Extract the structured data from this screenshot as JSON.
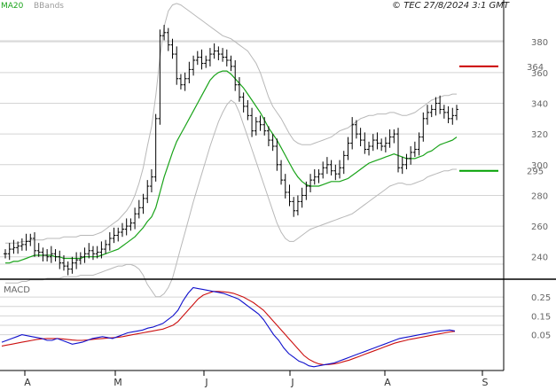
{
  "legend": {
    "ma": "MA20",
    "bb": "BBands"
  },
  "copyright": "© TEC 27/8/2024 3:1 GMT",
  "macd_label": "MACD",
  "colors": {
    "price": "#000000",
    "ma": "#19a319",
    "bands": "#b8b8b8",
    "resistance": "#cc0000",
    "support": "#00a000",
    "macd": "#1010cc",
    "signal": "#cc1010",
    "grid": "#d4d4d4"
  },
  "chart_data": {
    "type": "bar",
    "x_categories": [
      "A",
      "M",
      "J",
      "J",
      "A",
      "S"
    ],
    "price_axis": {
      "ticks": [
        240,
        260,
        280,
        300,
        320,
        340,
        360,
        380
      ],
      "range": [
        226,
        398
      ]
    },
    "macd_axis": {
      "ticks": [
        "0.25",
        "0.15",
        "0.05"
      ],
      "values": [
        0.25,
        0.15,
        0.05
      ],
      "range": [
        -0.14,
        0.34
      ]
    },
    "levels": [
      {
        "name": "resistance",
        "value": 364,
        "label": "364"
      },
      {
        "name": "support",
        "value": 296,
        "label": "295"
      }
    ],
    "closes": [
      242,
      245,
      246,
      247,
      248,
      250,
      252,
      244,
      243,
      241,
      240,
      242,
      240,
      236,
      234,
      232,
      236,
      238,
      240,
      242,
      244,
      242,
      243,
      245,
      248,
      252,
      254,
      256,
      258,
      260,
      262,
      268,
      272,
      278,
      286,
      292,
      330,
      384,
      386,
      378,
      372,
      356,
      352,
      356,
      362,
      368,
      370,
      366,
      368,
      372,
      374,
      372,
      370,
      368,
      364,
      352,
      344,
      338,
      332,
      322,
      328,
      326,
      322,
      316,
      312,
      300,
      290,
      282,
      276,
      270,
      276,
      280,
      286,
      290,
      292,
      294,
      298,
      300,
      296,
      294,
      298,
      306,
      314,
      326,
      320,
      316,
      310,
      312,
      316,
      314,
      312,
      314,
      318,
      320,
      298,
      300,
      304,
      308,
      310,
      318,
      330,
      334,
      336,
      340,
      336,
      334,
      330,
      332,
      336
    ],
    "ma20": [
      236,
      236,
      237,
      237,
      238,
      239,
      240,
      241,
      241,
      241,
      241,
      241,
      240,
      240,
      239,
      239,
      239,
      239,
      239,
      240,
      240,
      240,
      240,
      241,
      242,
      243,
      244,
      245,
      247,
      249,
      251,
      253,
      256,
      259,
      263,
      266,
      272,
      282,
      292,
      300,
      308,
      315,
      320,
      325,
      330,
      335,
      340,
      345,
      350,
      355,
      358,
      360,
      361,
      361,
      359,
      356,
      353,
      350,
      346,
      342,
      338,
      334,
      329,
      324,
      320,
      316,
      311,
      306,
      301,
      296,
      292,
      289,
      287,
      286,
      286,
      286,
      287,
      288,
      289,
      289,
      289,
      290,
      291,
      293,
      295,
      297,
      299,
      301,
      302,
      303,
      304,
      305,
      306,
      307,
      306,
      305,
      304,
      304,
      304,
      305,
      306,
      308,
      309,
      311,
      313,
      314,
      315,
      316,
      318
    ],
    "bb_upper": [
      249,
      249,
      249,
      249,
      250,
      250,
      251,
      251,
      251,
      251,
      252,
      252,
      252,
      252,
      253,
      253,
      253,
      253,
      254,
      254,
      254,
      254,
      255,
      256,
      258,
      260,
      262,
      264,
      267,
      270,
      274,
      280,
      288,
      298,
      312,
      325,
      345,
      370,
      390,
      400,
      404,
      405,
      404,
      402,
      400,
      398,
      396,
      394,
      392,
      390,
      388,
      386,
      384,
      383,
      382,
      380,
      378,
      376,
      374,
      370,
      366,
      360,
      352,
      344,
      338,
      334,
      330,
      325,
      320,
      316,
      314,
      313,
      313,
      313,
      314,
      315,
      316,
      317,
      318,
      320,
      322,
      323,
      324,
      326,
      328,
      330,
      331,
      332,
      332,
      333,
      333,
      333,
      334,
      334,
      333,
      332,
      332,
      333,
      334,
      336,
      338,
      340,
      342,
      343,
      344,
      345,
      345,
      346,
      346
    ],
    "bb_lower": [
      223,
      223,
      223,
      223,
      224,
      224,
      225,
      225,
      225,
      225,
      226,
      226,
      226,
      226,
      227,
      227,
      227,
      227,
      228,
      228,
      228,
      228,
      229,
      230,
      231,
      232,
      233,
      234,
      234,
      235,
      235,
      234,
      232,
      228,
      222,
      218,
      214,
      214,
      216,
      220,
      226,
      236,
      246,
      256,
      266,
      276,
      285,
      294,
      303,
      312,
      320,
      328,
      334,
      339,
      342,
      340,
      334,
      326,
      318,
      310,
      302,
      294,
      286,
      278,
      270,
      262,
      256,
      252,
      250,
      250,
      252,
      254,
      256,
      258,
      259,
      260,
      261,
      262,
      263,
      264,
      265,
      266,
      267,
      268,
      270,
      272,
      274,
      276,
      278,
      280,
      282,
      284,
      286,
      287,
      288,
      288,
      287,
      287,
      288,
      289,
      290,
      292,
      293,
      294,
      295,
      296,
      296,
      297,
      297
    ],
    "macd": [
      0.01,
      0.02,
      0.03,
      0.04,
      0.05,
      0.045,
      0.04,
      0.035,
      0.03,
      0.02,
      0.02,
      0.03,
      0.02,
      0.01,
      0.0,
      0.005,
      0.01,
      0.02,
      0.03,
      0.035,
      0.04,
      0.035,
      0.03,
      0.04,
      0.05,
      0.06,
      0.065,
      0.07,
      0.075,
      0.085,
      0.09,
      0.1,
      0.11,
      0.13,
      0.15,
      0.18,
      0.23,
      0.27,
      0.3,
      0.295,
      0.29,
      0.285,
      0.28,
      0.275,
      0.27,
      0.26,
      0.25,
      0.24,
      0.22,
      0.2,
      0.18,
      0.16,
      0.13,
      0.09,
      0.05,
      0.02,
      -0.02,
      -0.05,
      -0.07,
      -0.09,
      -0.1,
      -0.115,
      -0.12,
      -0.115,
      -0.11,
      -0.105,
      -0.1,
      -0.09,
      -0.08,
      -0.07,
      -0.06,
      -0.05,
      -0.04,
      -0.03,
      -0.02,
      -0.01,
      0.0,
      0.01,
      0.02,
      0.03,
      0.035,
      0.04,
      0.045,
      0.05,
      0.055,
      0.06,
      0.065,
      0.07,
      0.072,
      0.075,
      0.07
    ],
    "signal": [
      -0.01,
      -0.005,
      0.0,
      0.005,
      0.01,
      0.015,
      0.02,
      0.025,
      0.028,
      0.03,
      0.03,
      0.03,
      0.028,
      0.025,
      0.022,
      0.02,
      0.02,
      0.022,
      0.025,
      0.028,
      0.03,
      0.032,
      0.034,
      0.036,
      0.04,
      0.045,
      0.05,
      0.055,
      0.06,
      0.065,
      0.07,
      0.075,
      0.08,
      0.09,
      0.1,
      0.12,
      0.15,
      0.18,
      0.21,
      0.24,
      0.26,
      0.27,
      0.28,
      0.28,
      0.278,
      0.275,
      0.27,
      0.26,
      0.25,
      0.235,
      0.22,
      0.2,
      0.18,
      0.15,
      0.12,
      0.09,
      0.06,
      0.03,
      0.0,
      -0.03,
      -0.06,
      -0.08,
      -0.095,
      -0.105,
      -0.11,
      -0.108,
      -0.105,
      -0.1,
      -0.092,
      -0.085,
      -0.075,
      -0.065,
      -0.055,
      -0.045,
      -0.035,
      -0.025,
      -0.015,
      -0.005,
      0.005,
      0.012,
      0.018,
      0.025,
      0.03,
      0.035,
      0.04,
      0.045,
      0.05,
      0.055,
      0.06,
      0.065,
      0.068
    ]
  }
}
